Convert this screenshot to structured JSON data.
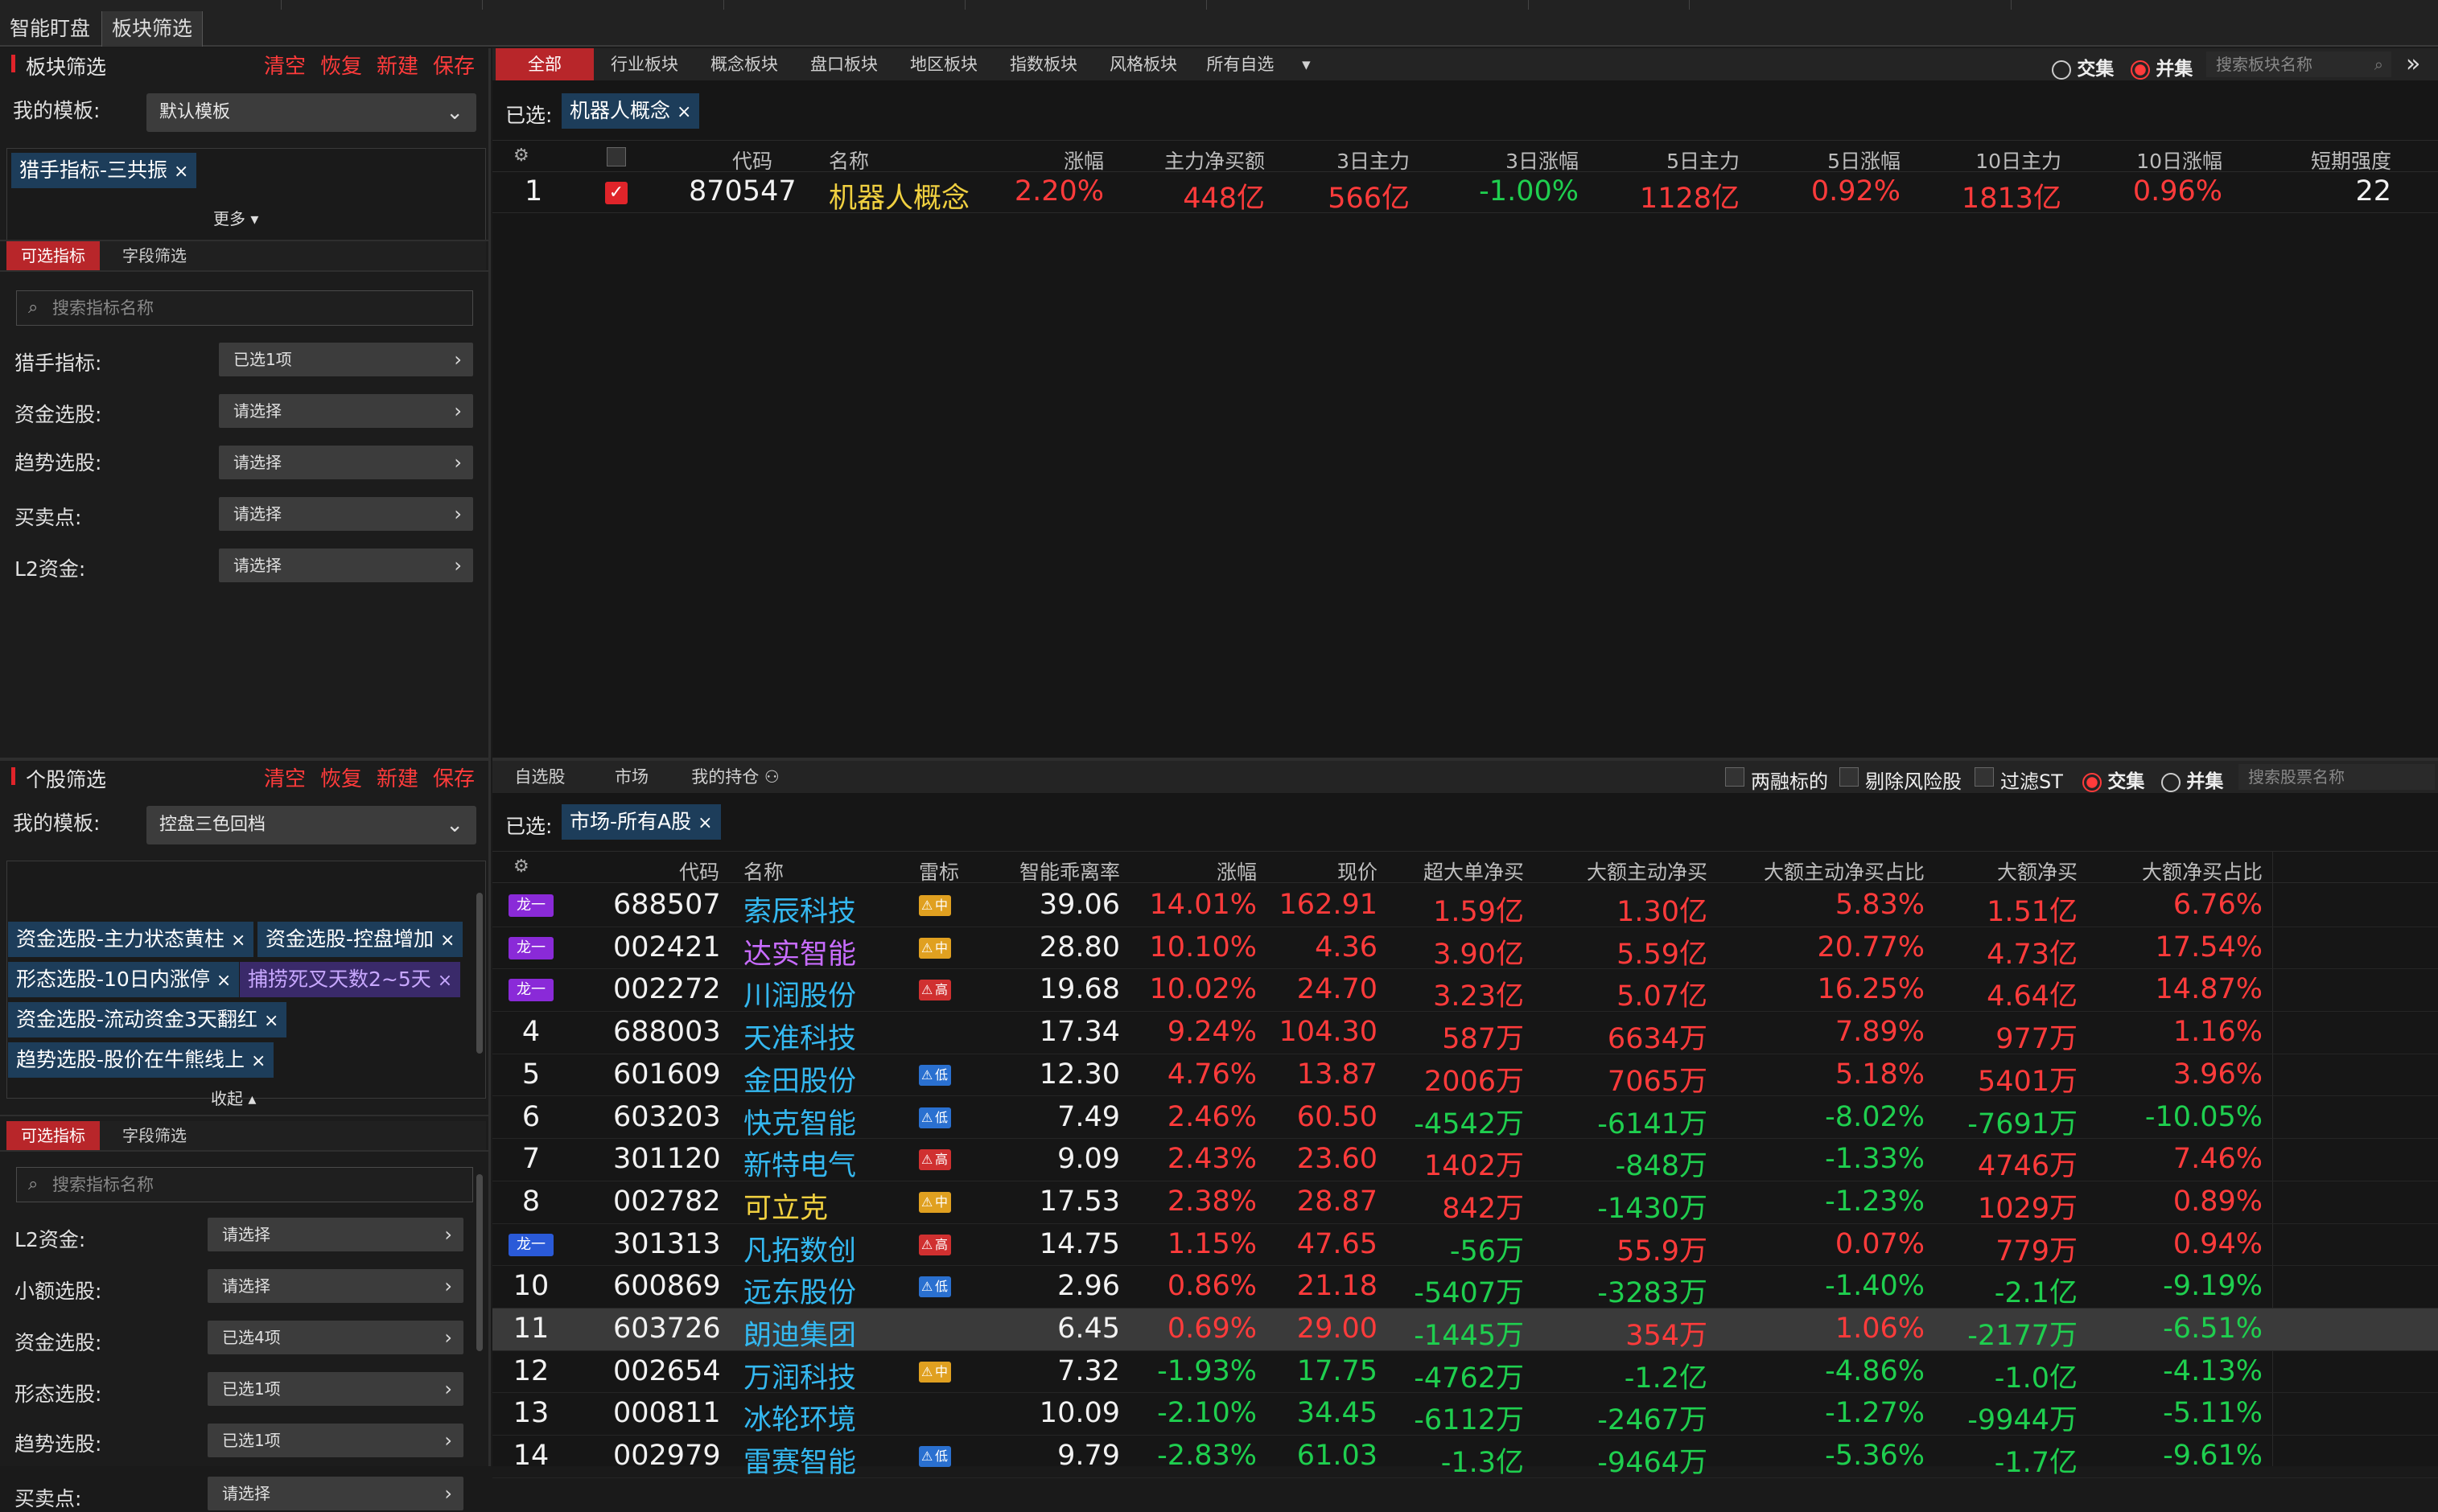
{
  "topbar": {
    "tab1": "智能盯盘",
    "tab2": "板块筛选"
  },
  "sector": {
    "title": "板块筛选",
    "actions": [
      "清空",
      "恢复",
      "新建",
      "保存"
    ],
    "template_label": "我的模板:",
    "template_value": "默认模板",
    "chips": [
      "猎手指标-三共振"
    ],
    "more": "更多",
    "subtabs": [
      "可选指标",
      "字段筛选"
    ],
    "search_placeholder": "搜索指标名称",
    "filters": [
      {
        "label": "猎手指标:",
        "value": "已选1项"
      },
      {
        "label": "资金选股:",
        "value": "请选择"
      },
      {
        "label": "趋势选股:",
        "value": "请选择"
      },
      {
        "label": "买卖点:",
        "value": "请选择"
      },
      {
        "label": "L2资金:",
        "value": "请选择"
      }
    ]
  },
  "stock": {
    "title": "个股筛选",
    "actions": [
      "清空",
      "恢复",
      "新建",
      "保存"
    ],
    "template_label": "我的模板:",
    "template_value": "控盘三色回档",
    "chips": [
      "资金选股-主力状态黄柱",
      "资金选股-控盘增加",
      "形态选股-10日内涨停",
      "捕捞死叉天数2~5天",
      "资金选股-流动资金3天翻红",
      "趋势选股-股价在牛熊线上"
    ],
    "collapse": "收起",
    "subtabs": [
      "可选指标",
      "字段筛选"
    ],
    "search_placeholder": "搜索指标名称",
    "filters": [
      {
        "label": "L2资金:",
        "value": "请选择"
      },
      {
        "label": "小额选股:",
        "value": "请选择"
      },
      {
        "label": "资金选股:",
        "value": "已选4项"
      },
      {
        "label": "形态选股:",
        "value": "已选1项"
      },
      {
        "label": "趋势选股:",
        "value": "已选1项"
      },
      {
        "label": "买卖点:",
        "value": "请选择"
      }
    ]
  },
  "sector_panel": {
    "tabs": [
      "全部",
      "行业板块",
      "概念板块",
      "盘口板块",
      "地区板块",
      "指数板块",
      "风格板块",
      "所有自选"
    ],
    "radio1": "交集",
    "radio2": "并集",
    "search_placeholder": "搜索板块名称",
    "selected_label": "已选:",
    "selected_chip": "机器人概念",
    "headers": [
      "代码",
      "名称",
      "涨幅",
      "主力净买额",
      "3日主力",
      "3日涨幅",
      "5日主力",
      "5日涨幅",
      "10日主力",
      "10日涨幅",
      "短期强度"
    ],
    "rows": [
      {
        "idx": "1",
        "code": "870547",
        "name": "机器人概念",
        "chg": "2.20%",
        "main": "448亿",
        "main3": "566亿",
        "chg3": "-1.00%",
        "main5": "1128亿",
        "chg5": "0.92%",
        "main10": "1813亿",
        "chg10": "0.96%",
        "strength": "22"
      }
    ]
  },
  "stock_panel": {
    "tabs": [
      "自选股",
      "市场",
      "我的持仓"
    ],
    "checks": [
      "两融标的",
      "剔除风险股",
      "过滤ST"
    ],
    "radio1": "交集",
    "radio2": "并集",
    "search_placeholder": "搜索股票名称",
    "selected_label": "已选:",
    "selected_chip": "市场-所有A股",
    "headers": [
      "代码",
      "名称",
      "雷标",
      "智能乖离率",
      "涨幅",
      "现价",
      "超大单净买",
      "大额主动净买",
      "大额主动净买占比",
      "大额净买",
      "大额净买占比"
    ],
    "rows": [
      {
        "idx": "",
        "badge": "龙一",
        "badge_color": "purple",
        "code": "688507",
        "name": "索辰科技",
        "name_color": "c",
        "risk": "中",
        "bias": "39.06",
        "chg": "14.01%",
        "price": "162.91",
        "xl": "1.59亿",
        "la": "1.30亿",
        "lap": "5.83%",
        "ln": "1.51亿",
        "lnp": "6.76%",
        "color": "r"
      },
      {
        "idx": "",
        "badge": "龙一",
        "badge_color": "purple",
        "code": "002421",
        "name": "达实智能",
        "name_color": "m",
        "risk": "中",
        "bias": "28.80",
        "chg": "10.10%",
        "price": "4.36",
        "xl": "3.90亿",
        "la": "5.59亿",
        "lap": "20.77%",
        "ln": "4.73亿",
        "lnp": "17.54%",
        "color": "r"
      },
      {
        "idx": "",
        "badge": "龙一",
        "badge_color": "purple",
        "code": "002272",
        "name": "川润股份",
        "name_color": "c",
        "risk": "高",
        "bias": "19.68",
        "chg": "10.02%",
        "price": "24.70",
        "xl": "3.23亿",
        "la": "5.07亿",
        "lap": "16.25%",
        "ln": "4.64亿",
        "lnp": "14.87%",
        "color": "r"
      },
      {
        "idx": "4",
        "badge": "",
        "code": "688003",
        "name": "天准科技",
        "name_color": "c",
        "risk": "",
        "bias": "17.34",
        "chg": "9.24%",
        "price": "104.30",
        "xl": "587万",
        "la": "6634万",
        "lap": "7.89%",
        "ln": "977万",
        "lnp": "1.16%",
        "color": "r"
      },
      {
        "idx": "5",
        "badge": "",
        "code": "601609",
        "name": "金田股份",
        "name_color": "c",
        "risk": "低",
        "bias": "12.30",
        "chg": "4.76%",
        "price": "13.87",
        "xl": "2006万",
        "la": "7065万",
        "lap": "5.18%",
        "ln": "5401万",
        "lnp": "3.96%",
        "color": "r"
      },
      {
        "idx": "6",
        "badge": "",
        "code": "603203",
        "name": "快克智能",
        "name_color": "c",
        "risk": "低",
        "bias": "7.49",
        "chg": "2.46%",
        "price": "60.50",
        "xl": "-4542万",
        "la": "-6141万",
        "lap": "-8.02%",
        "ln": "-7691万",
        "lnp": "-10.05%",
        "color": "mix"
      },
      {
        "idx": "7",
        "badge": "",
        "code": "301120",
        "name": "新特电气",
        "name_color": "c",
        "risk": "高",
        "bias": "9.09",
        "chg": "2.43%",
        "price": "23.60",
        "xl": "1402万",
        "la": "-848万",
        "lap": "-1.33%",
        "ln": "4746万",
        "lnp": "7.46%",
        "color": "mix"
      },
      {
        "idx": "8",
        "badge": "",
        "code": "002782",
        "name": "可立克",
        "name_color": "y",
        "risk": "中",
        "bias": "17.53",
        "chg": "2.38%",
        "price": "28.87",
        "xl": "842万",
        "la": "-1430万",
        "lap": "-1.23%",
        "ln": "1029万",
        "lnp": "0.89%",
        "color": "mix"
      },
      {
        "idx": "",
        "badge": "龙一",
        "badge_color": "blue",
        "code": "301313",
        "name": "凡拓数创",
        "name_color": "c",
        "risk": "高",
        "bias": "14.75",
        "chg": "1.15%",
        "price": "47.65",
        "xl": "-56万",
        "la": "55.9万",
        "lap": "0.07%",
        "ln": "779万",
        "lnp": "0.94%",
        "color": "mix"
      },
      {
        "idx": "10",
        "badge": "",
        "code": "600869",
        "name": "远东股份",
        "name_color": "c",
        "risk": "低",
        "bias": "2.96",
        "chg": "0.86%",
        "price": "21.18",
        "xl": "-5407万",
        "la": "-3283万",
        "lap": "-1.40%",
        "ln": "-2.1亿",
        "lnp": "-9.19%",
        "color": "mix"
      },
      {
        "idx": "11",
        "badge": "",
        "code": "603726",
        "name": "朗迪集团",
        "name_color": "c",
        "risk": "",
        "bias": "6.45",
        "chg": "0.69%",
        "price": "29.00",
        "xl": "-1445万",
        "la": "354万",
        "lap": "1.06%",
        "ln": "-2177万",
        "lnp": "-6.51%",
        "color": "mix",
        "selected": true
      },
      {
        "idx": "12",
        "badge": "",
        "code": "002654",
        "name": "万润科技",
        "name_color": "c",
        "risk": "中",
        "bias": "7.32",
        "chg": "-1.93%",
        "price": "17.75",
        "xl": "-4762万",
        "la": "-1.2亿",
        "lap": "-4.86%",
        "ln": "-1.0亿",
        "lnp": "-4.13%",
        "color": "g"
      },
      {
        "idx": "13",
        "badge": "",
        "code": "000811",
        "name": "冰轮环境",
        "name_color": "c",
        "risk": "",
        "bias": "10.09",
        "chg": "-2.10%",
        "price": "34.45",
        "xl": "-6112万",
        "la": "-2467万",
        "lap": "-1.27%",
        "ln": "-9944万",
        "lnp": "-5.11%",
        "color": "g"
      },
      {
        "idx": "14",
        "badge": "",
        "code": "002979",
        "name": "雷赛智能",
        "name_color": "c",
        "risk": "低",
        "bias": "9.79",
        "chg": "-2.83%",
        "price": "61.03",
        "xl": "-1.3亿",
        "la": "-9464万",
        "lap": "-5.36%",
        "ln": "-1.7亿",
        "lnp": "-9.61%",
        "color": "g"
      }
    ]
  }
}
